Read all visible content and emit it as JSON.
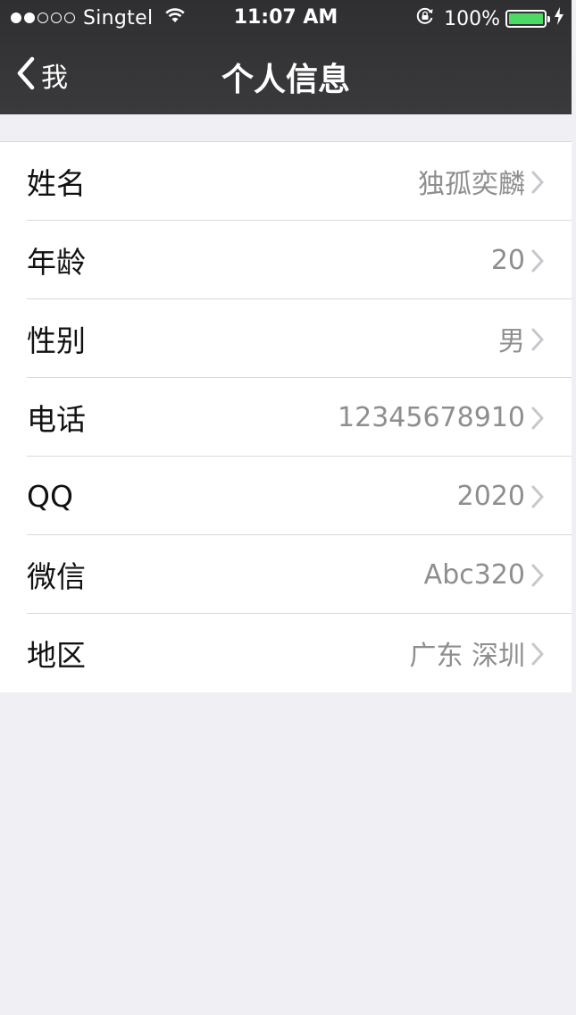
{
  "status_bar": {
    "signal_full": 2,
    "signal_empty": 3,
    "carrier": "Singtel",
    "time": "11:07 AM",
    "battery_percent": "100%",
    "battery_level": 1.0,
    "icons": [
      "wifi-icon",
      "rotation-lock-icon",
      "battery-icon",
      "charging-bolt-icon"
    ]
  },
  "nav": {
    "back_label": "我",
    "title": "个人信息",
    "back_icon": "chevron-left-icon"
  },
  "profile": {
    "rows": [
      {
        "label": "姓名",
        "value": "独孤奕麟"
      },
      {
        "label": "年龄",
        "value": "20"
      },
      {
        "label": "性别",
        "value": "男"
      },
      {
        "label": "电话",
        "value": "12345678910"
      },
      {
        "label": "QQ",
        "value": "2020"
      },
      {
        "label": "微信",
        "value": "Abc320"
      },
      {
        "label": "地区",
        "value": "广东 深圳"
      }
    ],
    "row_icon": "chevron-right-icon"
  },
  "colors": {
    "nav_background": "#333335",
    "battery_fill": "#4cd964",
    "value_text": "#8e8e8e",
    "page_background": "#efeff4"
  }
}
